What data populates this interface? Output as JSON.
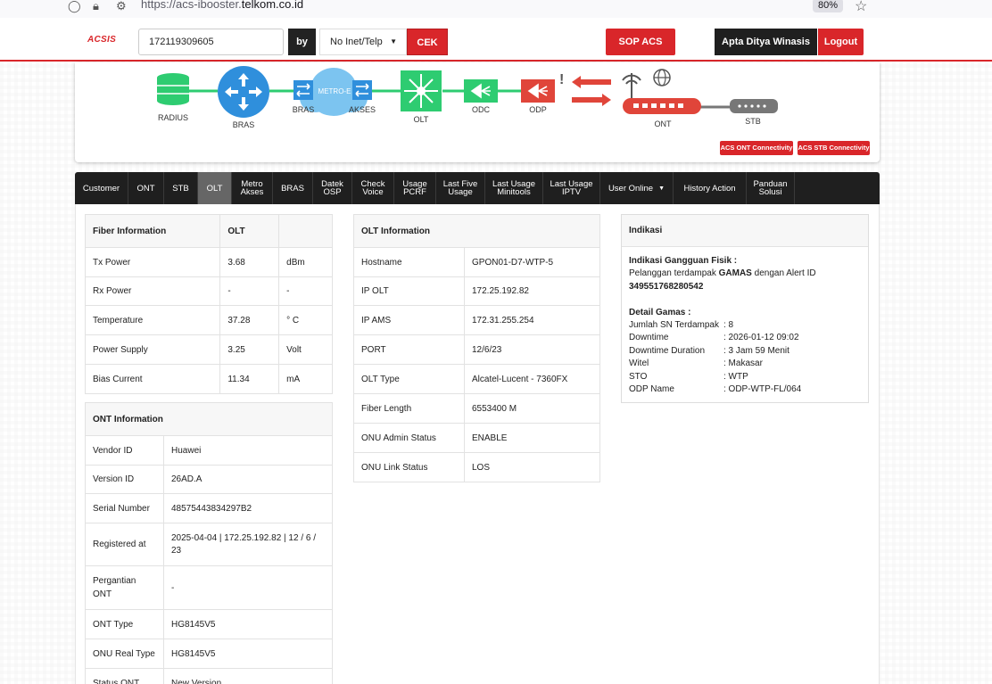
{
  "browser": {
    "url_prefix": "https://acs-ibooster.",
    "url_domain": "telkom.co.id",
    "zoom": "80%"
  },
  "header": {
    "logo": "ACSIS",
    "search_value": "172119309605",
    "by_label": "by",
    "select_value": "No Inet/Telp",
    "cek_label": "CEK",
    "sop_label": "SOP ACS",
    "user_name": "Apta Ditya Winasis",
    "logout_label": "Logout"
  },
  "topology": {
    "nodes": {
      "radius": "RADIUS",
      "bras": "BRAS",
      "bras2": "BRAS",
      "metro": "METRO-E",
      "akses": "AKSES",
      "olt": "OLT",
      "odc": "ODC",
      "odp": "ODP",
      "ont": "ONT",
      "stb": "STB"
    },
    "acs_ont_btn": "ACS ONT Connectivity",
    "acs_stb_btn": "ACS STB Connectivity",
    "colors": {
      "green": "#2ecc71",
      "blue": "#2f8fdc",
      "red": "#e0453a",
      "gray": "#777777"
    }
  },
  "tabs": [
    {
      "label1": "Customer",
      "label2": ""
    },
    {
      "label1": "ONT",
      "label2": ""
    },
    {
      "label1": "STB",
      "label2": ""
    },
    {
      "label1": "OLT",
      "label2": ""
    },
    {
      "label1": "Metro",
      "label2": "Akses"
    },
    {
      "label1": "BRAS",
      "label2": ""
    },
    {
      "label1": "Datek",
      "label2": "OSP"
    },
    {
      "label1": "Check",
      "label2": "Voice"
    },
    {
      "label1": "Usage",
      "label2": "PCRF"
    },
    {
      "label1": "Last Five",
      "label2": "Usage"
    },
    {
      "label1": "Last Usage",
      "label2": "Minitools"
    },
    {
      "label1": "Last Usage",
      "label2": "IPTV"
    },
    {
      "label1": "User Online",
      "label2": ""
    },
    {
      "label1": "History Action",
      "label2": ""
    },
    {
      "label1": "Panduan",
      "label2": "Solusi"
    }
  ],
  "fiber": {
    "header": [
      "Fiber Information",
      "OLT",
      ""
    ],
    "rows": [
      [
        "Tx Power",
        "3.68",
        "dBm"
      ],
      [
        "Rx Power",
        "-",
        "-"
      ],
      [
        "Temperature",
        "37.28",
        "° C"
      ],
      [
        "Power Supply",
        "3.25",
        "Volt"
      ],
      [
        "Bias Current",
        "11.34",
        "mA"
      ]
    ]
  },
  "ont": {
    "header": "ONT Information",
    "rows": [
      [
        "Vendor ID",
        "Huawei"
      ],
      [
        "Version ID",
        "26AD.A"
      ],
      [
        "Serial Number",
        "48575443834297B2"
      ],
      [
        "Registered at",
        "2025-04-04 | 172.25.192.82 | 12 / 6 / 23"
      ],
      [
        "Pergantian ONT",
        "-"
      ],
      [
        "ONT Type",
        "HG8145V5"
      ],
      [
        "ONU Real Type",
        "HG8145V5"
      ],
      [
        "Status ONT",
        "New Version"
      ]
    ]
  },
  "olt": {
    "header": "OLT Information",
    "rows": [
      [
        "Hostname",
        "GPON01-D7-WTP-5"
      ],
      [
        "IP OLT",
        "172.25.192.82"
      ],
      [
        "IP AMS",
        "172.31.255.254"
      ],
      [
        "PORT",
        "12/6/23"
      ],
      [
        "OLT Type",
        "Alcatel-Lucent - 7360FX"
      ],
      [
        "Fiber Length",
        "6553400 M"
      ],
      [
        "ONU Admin Status",
        "ENABLE"
      ],
      [
        "ONU Link Status",
        "LOS"
      ]
    ]
  },
  "indikasi": {
    "header": "Indikasi",
    "title": "Indikasi Gangguan Fisik :",
    "line1_pre": "Pelanggan terdampak ",
    "line1_bold": "GAMAS",
    "line1_post": " dengan Alert ID",
    "alert_id": "349551768280542",
    "detail_title": "Detail Gamas :",
    "details": [
      [
        "Jumlah SN Terdampak",
        ": 8"
      ],
      [
        "Downtime",
        ": 2026-01-12 09:02"
      ],
      [
        "Downtime Duration",
        ": 3 Jam 59 Menit"
      ],
      [
        "Witel",
        ": Makasar"
      ],
      [
        "STO",
        ": WTP"
      ],
      [
        "ODP Name",
        ": ODP-WTP-FL/064"
      ]
    ]
  }
}
